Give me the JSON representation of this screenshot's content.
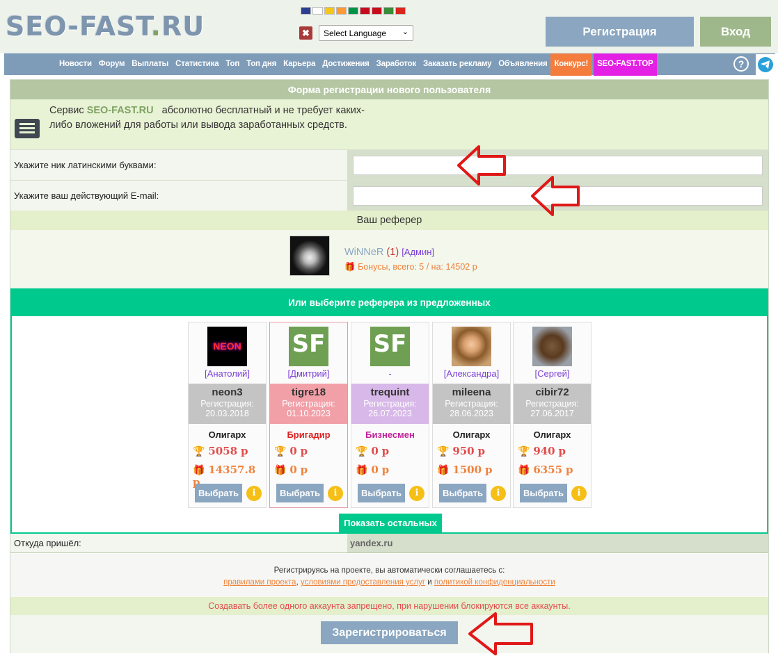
{
  "header": {
    "logo_main": "SEO-FAST",
    "logo_dot": ".",
    "logo_tld": "RU",
    "lang_close": "✖",
    "lang_select": "Select Language",
    "register_label": "Регистрация",
    "login_label": "Вход"
  },
  "flags": [
    "#2c3e8f",
    "#ffffff",
    "#f5c518",
    "#ff9933",
    "#009246",
    "#c60b1e",
    "#c80c1c",
    "#3a8b3a",
    "#da251d"
  ],
  "nav": {
    "items": [
      "Новости",
      "Форум",
      "Выплаты",
      "Статистика",
      "Топ",
      "Топ дня",
      "Карьера",
      "Достижения",
      "Заработок",
      "Заказать рекламу",
      "Объявления"
    ],
    "contest": "Конкурс!",
    "seotop": "SEO-FAST.TOP",
    "help": "?"
  },
  "form": {
    "title": "Форма регистрации нового пользователя",
    "intro_pre": "Сервис ",
    "intro_brand": "SEO-FAST.RU",
    "intro_post": "абсолютно бесплатный и не требует каких-либо вложений для работы или вывода заработанных средств.",
    "nick_label": "Укажите ник латинскими буквами:",
    "email_label": "Укажите ваш действующий E-mail:"
  },
  "referer": {
    "heading": "Ваш реферер",
    "nick": "WiNNeR",
    "count": "(1)",
    "role": "[Админ]",
    "bonus": "Бонусы, всего: 5 / на: 14502 р"
  },
  "choose": {
    "heading": "Или выберите реферера из предложенных",
    "select_label": "Выбрать",
    "info_label": "i",
    "show_more": "Показать остальных",
    "cards": [
      {
        "real_name": "[Анатолий]",
        "login": "neon3",
        "reg_label": "Регистрация:",
        "reg_date": "20.03.2018",
        "status": "Олигарх",
        "status_color": "#222222",
        "earned": "5058",
        "bonus": "14357.8",
        "band": "#c4c4c4",
        "pic": "neon"
      },
      {
        "real_name": "[Дмитрий]",
        "login": "tigre18",
        "reg_label": "Регистрация:",
        "reg_date": "01.10.2023",
        "status": "Бригадир",
        "status_color": "#e02020",
        "earned": "0",
        "bonus": "0",
        "band": "#f2a0a8",
        "pic": "sf"
      },
      {
        "real_name": "-",
        "login": "trequint",
        "reg_label": "Регистрация:",
        "reg_date": "26.07.2023",
        "status": "Бизнесмен",
        "status_color": "#c0209a",
        "earned": "0",
        "bonus": "0",
        "band": "#d8b8e8",
        "pic": "sf"
      },
      {
        "real_name": "[Александра]",
        "login": "mileena",
        "reg_label": "Регистрация:",
        "reg_date": "28.06.2023",
        "status": "Олигарх",
        "status_color": "#222222",
        "earned": "950",
        "bonus": "1500",
        "band": "#c4c4c4",
        "pic": "girl"
      },
      {
        "real_name": "[Сергей]",
        "login": "cibir72",
        "reg_label": "Регистрация:",
        "reg_date": "27.06.2017",
        "status": "Олигарх",
        "status_color": "#222222",
        "earned": "940",
        "bonus": "6355",
        "band": "#c4c4c4",
        "pic": "bear"
      }
    ],
    "currency": "р"
  },
  "from": {
    "label": "Откуда пришёл:",
    "value": "yandex.ru"
  },
  "agreement": {
    "text": "Регистрируясь на проекте, вы автоматически соглашаетесь с:",
    "link1": "правилами проекта",
    "link2": "условиями предоставления услуг",
    "and": "и",
    "link3": "политикой конфиденциальности"
  },
  "warning": "Создавать более одного аккаунта запрещено, при нарушении блокируются все аккаунты.",
  "submit_label": "Зарегистрироваться",
  "colors": {
    "accent": "#00c98d",
    "header_blue": "#8aa6c1",
    "green_btn": "#9fb88b",
    "danger": "#e24c4c",
    "orange": "#f0823c"
  }
}
